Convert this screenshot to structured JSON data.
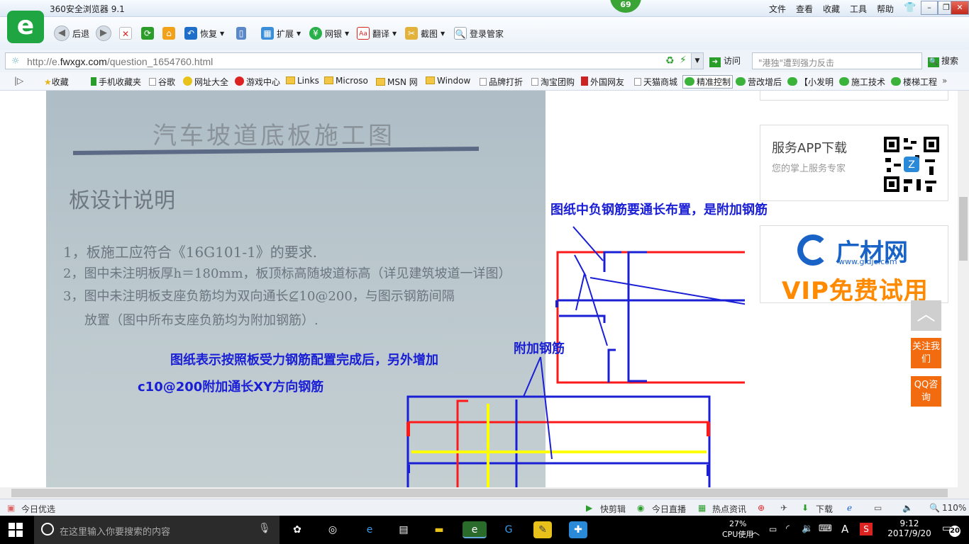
{
  "window": {
    "title": "360安全浏览器 9.1",
    "badge": "69",
    "menus": [
      "文件",
      "查看",
      "收藏",
      "工具",
      "帮助"
    ]
  },
  "toolbar": {
    "back": "后退",
    "restore": "恢复",
    "extend": "扩展",
    "netbank": "网银",
    "translate": "翻译",
    "screenshot": "截图",
    "login": "登录管家"
  },
  "address": {
    "url_prefix": "http://e.",
    "url_host": "fwxgx.com",
    "url_path": "/question_1654760.html",
    "visit": "访问",
    "search_placeholder": "\"港独\"遭到强力反击",
    "search_button": "搜索"
  },
  "favorites": [
    {
      "label": "收藏",
      "icon": "star"
    },
    {
      "label": "手机收藏夹",
      "icon": "phone"
    },
    {
      "label": "谷歌",
      "icon": "page"
    },
    {
      "label": "网址大全",
      "icon": "globe"
    },
    {
      "label": "游戏中心",
      "icon": "game"
    },
    {
      "label": "Links",
      "icon": "folder"
    },
    {
      "label": "Microso",
      "icon": "folder"
    },
    {
      "label": "MSN 网",
      "icon": "folder"
    },
    {
      "label": "Window",
      "icon": "folder"
    },
    {
      "label": "品牌打折",
      "icon": "page"
    },
    {
      "label": "淘宝团购",
      "icon": "page"
    },
    {
      "label": "外国网友",
      "icon": "page"
    },
    {
      "label": "天猫商城",
      "icon": "page"
    },
    {
      "label": "精准控制",
      "icon": "wechat"
    },
    {
      "label": "营改增后",
      "icon": "wechat"
    },
    {
      "label": "【小发明",
      "icon": "wechat"
    },
    {
      "label": "施工技术",
      "icon": "wechat"
    },
    {
      "label": "楼梯工程",
      "icon": "wechat"
    }
  ],
  "photo": {
    "title": "汽车坡道底板施工图",
    "heading": "板设计说明",
    "lines": [
      "1，板施工应符合《16G101-1》的要求.",
      "2，图中未注明板厚h＝180mm，板顶标高随坡道标高（详见建筑坡道一详图）",
      "3，图中未注明板支座负筋均为双向通长⊈10@200，与图示钢筋间隔",
      "放置（图中所布支座负筋均为附加钢筋）."
    ]
  },
  "annotations": {
    "top_note": "图纸中负钢筋要通长布置，是附加钢筋",
    "mid_note": "图纸表示按照板受力钢筋配置完成后，另外增加",
    "mid_note2": "c10@200附加通长XY方向钢筋",
    "extra_rebar": "附加钢筋"
  },
  "sidebar": {
    "app_title": "服务APP下载",
    "app_sub": "您的掌上服务专家",
    "gc_logo": "广材网",
    "gc_url": "www.gldjc.com",
    "gc_vip": "VIP免费试用",
    "to_top": "︿",
    "follow": "关注我们",
    "qq": "QQ咨询"
  },
  "statusbar": {
    "left": "今日优选",
    "items": [
      "快剪辑",
      "今日直播",
      "热点资讯",
      "下载"
    ],
    "zoom": "110%"
  },
  "taskbar": {
    "search_placeholder": "在这里输入你要搜索的内容",
    "cpu_percent": "27%",
    "cpu_label": "CPU使用",
    "ime": "A",
    "time": "9:12",
    "date": "2017/9/20",
    "notifications": "20"
  },
  "colors": {
    "rebar_red": "#ff1a1a",
    "rebar_blue": "#1a1fd6",
    "rebar_yellow": "#ffff00",
    "accent_green": "#3aa535",
    "orange": "#f26b0f"
  }
}
